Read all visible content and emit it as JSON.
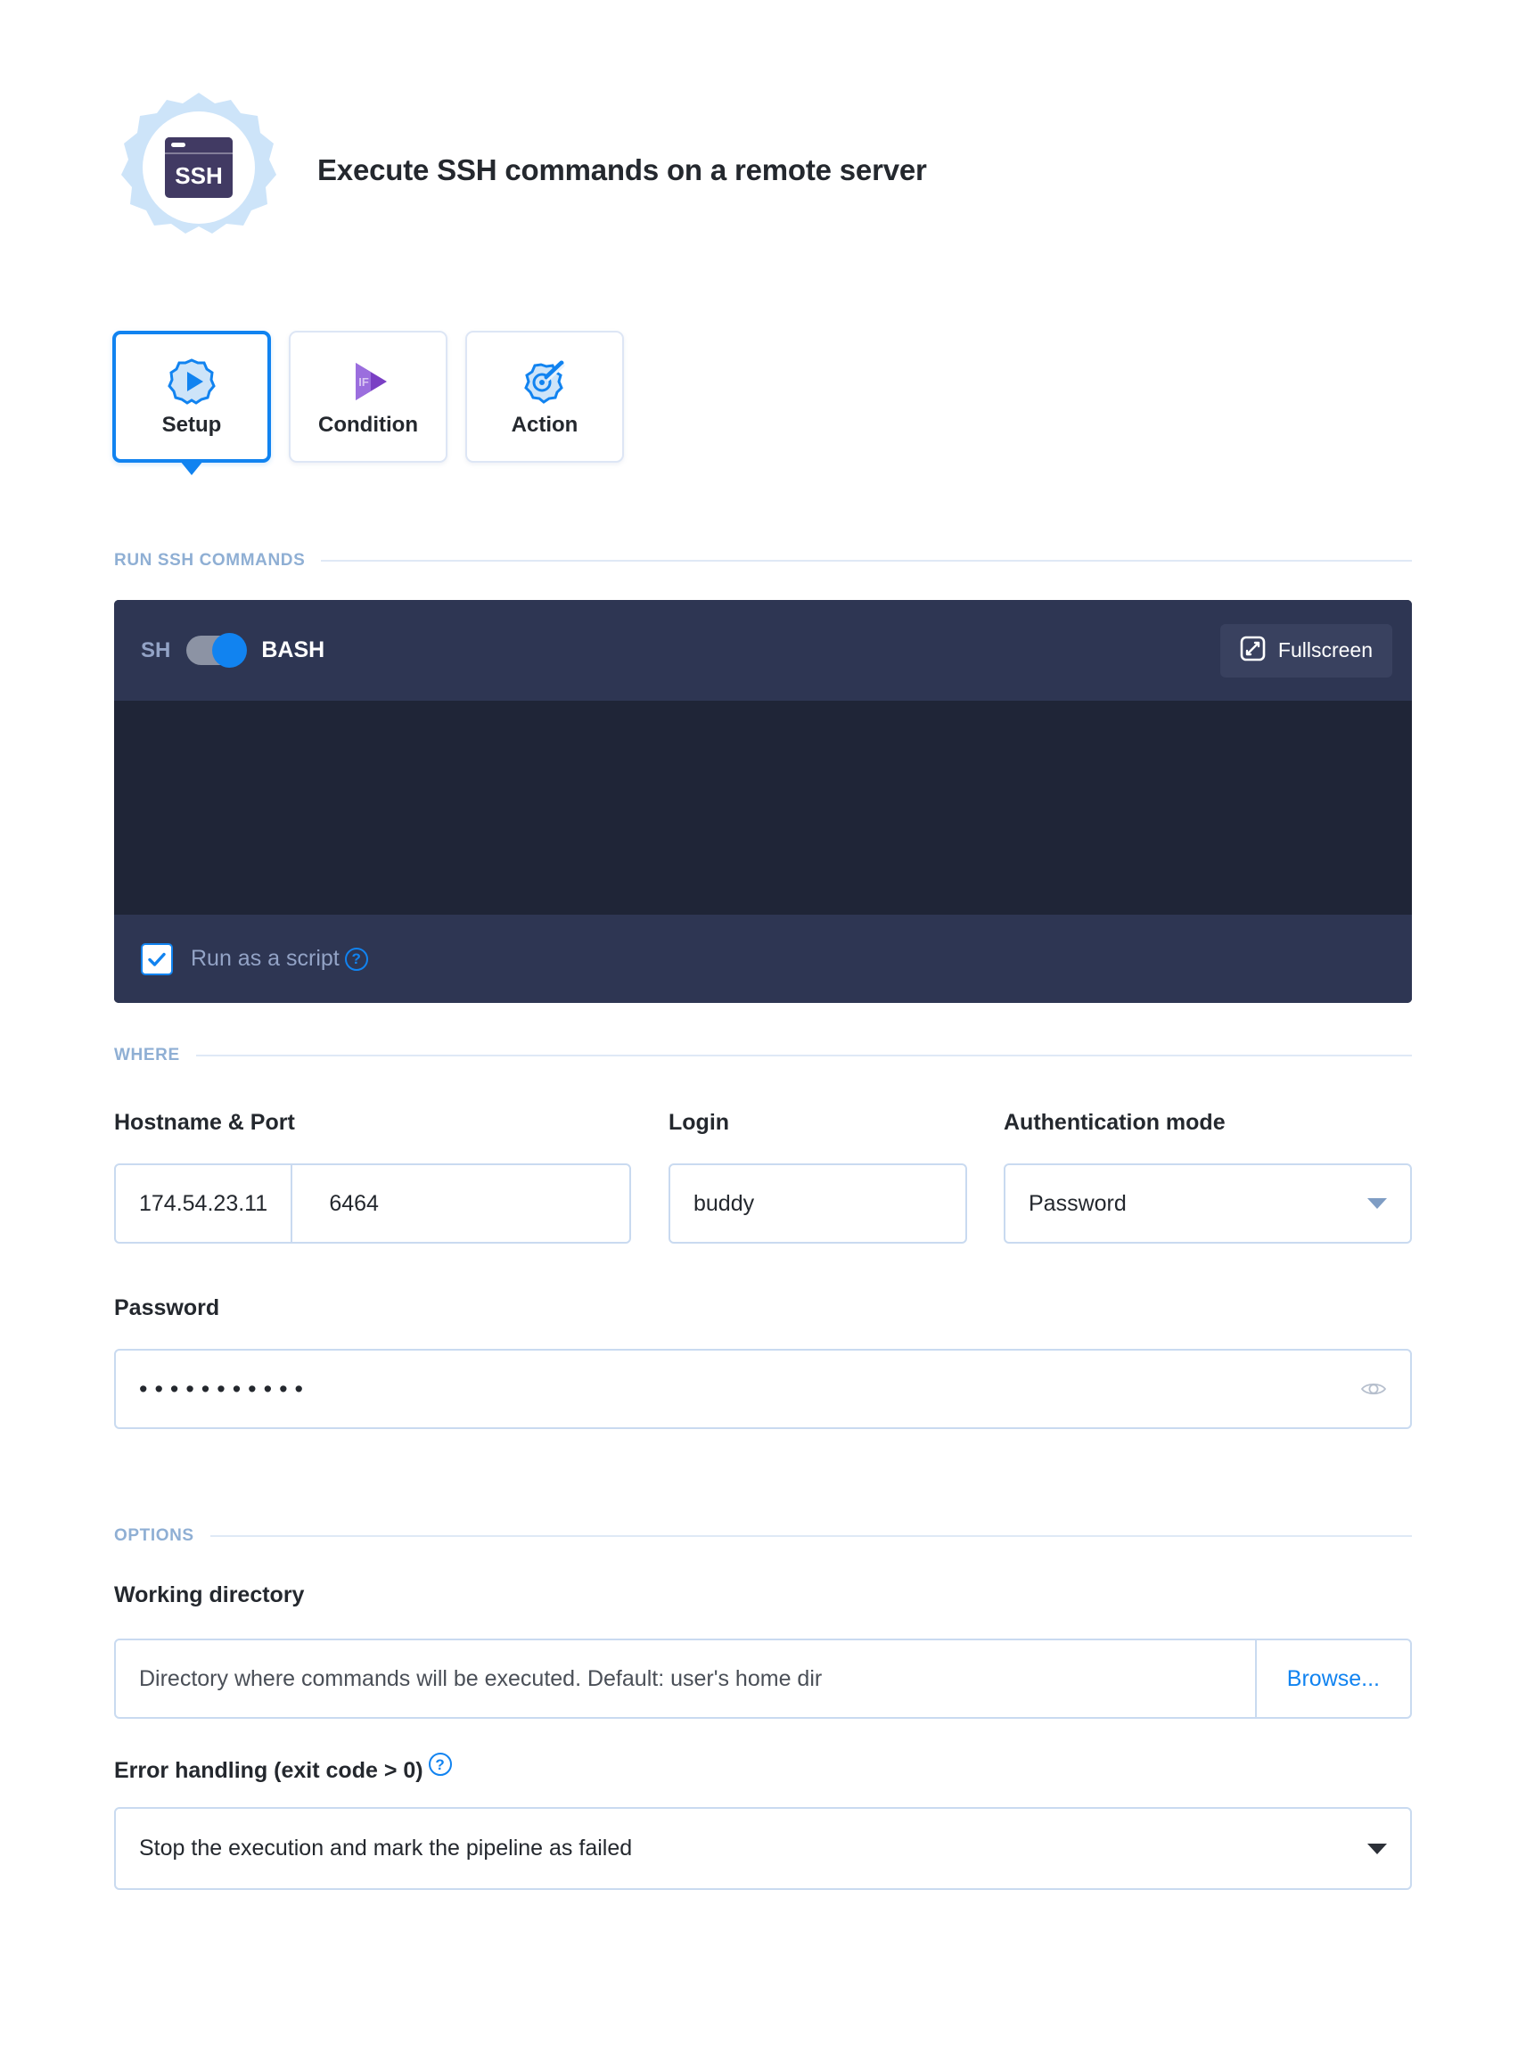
{
  "header": {
    "title": "Execute SSH commands on a remote server",
    "icon_label": "SSH",
    "icon_name": "ssh-gear-icon"
  },
  "tabs": [
    {
      "label": "Setup",
      "icon": "gear-play-icon",
      "active": true
    },
    {
      "label": "Condition",
      "icon": "if-play-icon",
      "active": false
    },
    {
      "label": "Action",
      "icon": "gear-wand-icon",
      "active": false
    }
  ],
  "sections": {
    "run_ssh_commands": "RUN SSH COMMANDS",
    "where": "WHERE",
    "options": "OPTIONS"
  },
  "editor": {
    "shell_left_label": "SH",
    "shell_right_label": "BASH",
    "toggle_state": "BASH",
    "fullscreen_label": "Fullscreen",
    "fullscreen_icon": "fullscreen-icon",
    "code": "",
    "run_as_script_label": "Run as a script",
    "run_as_script_checked": true,
    "help_icon": "?"
  },
  "where": {
    "hostname_label": "Hostname & Port",
    "hostname_value": "174.54.23.11",
    "port_value": "6464",
    "login_label": "Login",
    "login_value": "buddy",
    "auth_mode_label": "Authentication mode",
    "auth_mode_value": "Password",
    "password_label": "Password",
    "password_masked": "•••••••••••",
    "password_reveal_icon": "eye-icon"
  },
  "options": {
    "working_dir_label": "Working directory",
    "working_dir_placeholder": "Directory where commands will be executed. Default: user's home dir",
    "browse_label": "Browse...",
    "error_handling_label": "Error handling (exit code > 0)",
    "error_handling_help": "?",
    "error_handling_value": "Stop the execution and mark the pipeline as failed"
  },
  "colors": {
    "accent": "#1183f0",
    "editor_bg": "#1f2537",
    "editor_chrome": "#2e3653",
    "section_label": "#8fafd4",
    "border": "#c9daf0",
    "icon_dark": "#413a63",
    "icon_light": "#cde4f9"
  }
}
